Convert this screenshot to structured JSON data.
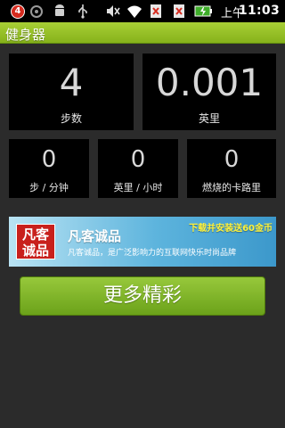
{
  "status_bar": {
    "notification_count": "4",
    "ampm": "上午",
    "time": "11:03",
    "icons": [
      "notification-badge-icon",
      "app-icon",
      "android-icon",
      "usb-icon",
      "mute-icon",
      "wifi-icon",
      "sim-missing-icon",
      "sim-missing-icon",
      "battery-charging-icon"
    ]
  },
  "title_bar": {
    "title": "健身器"
  },
  "stats_top": [
    {
      "value": "4",
      "label": "步数"
    },
    {
      "value": "0.001",
      "label": "英里"
    }
  ],
  "stats_bottom": [
    {
      "value": "0",
      "label": "步 / 分钟"
    },
    {
      "value": "0",
      "label": "英里 / 小时"
    },
    {
      "value": "0",
      "label": "燃烧的卡路里"
    }
  ],
  "ad": {
    "logo_text": "凡客诚品",
    "name": "凡客诚品",
    "description": "凡客诚品，是广泛影响力的互联网快乐时尚品牌",
    "promo": "下载并安装送60金币"
  },
  "more_button": {
    "label": "更多精彩"
  },
  "colors": {
    "accent": "#8fbf2a",
    "background": "#2b2b2b",
    "card": "#000000"
  }
}
